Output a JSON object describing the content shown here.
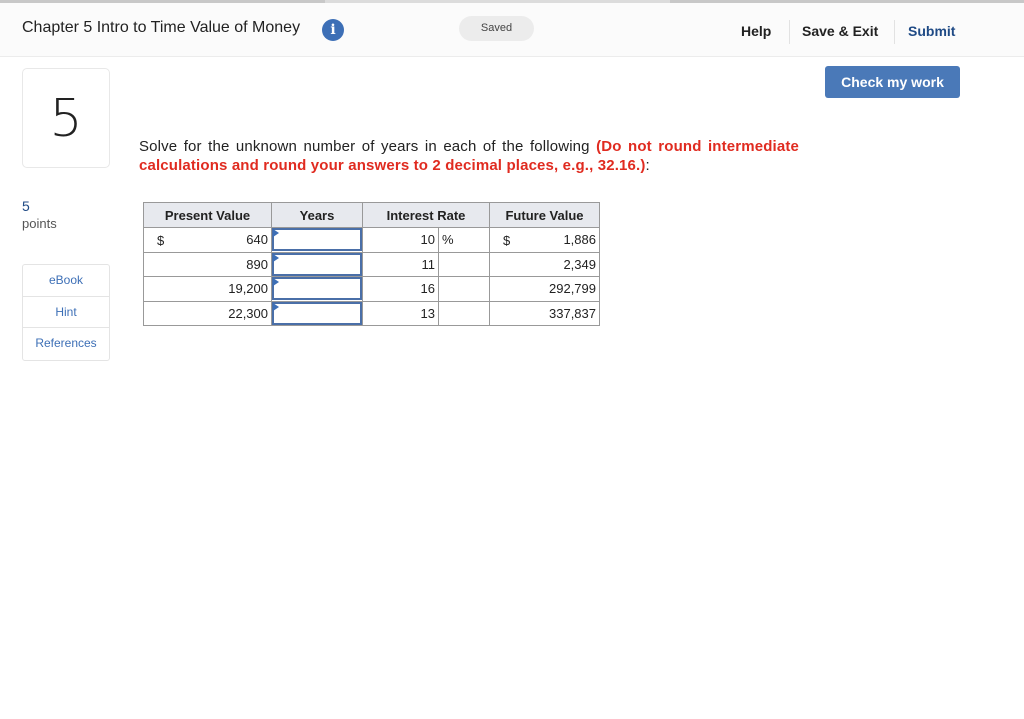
{
  "header": {
    "title": "Chapter 5 Intro to Time Value of Money",
    "info_icon": "i",
    "status": "Saved",
    "nav": {
      "help": "Help",
      "save_exit": "Save & Exit",
      "submit": "Submit"
    }
  },
  "actions": {
    "check_my_work": "Check my work"
  },
  "question": {
    "number": "5",
    "points_value": "5",
    "points_label": "points",
    "tools": [
      "eBook",
      "Hint",
      "References"
    ],
    "prompt_plain": "Solve for the unknown number of years in each of the following ",
    "prompt_emphasis": "(Do not round intermediate calculations and round your answers to 2 decimal places, e.g., 32.16.)",
    "prompt_end": ":"
  },
  "table": {
    "headers": [
      "Present Value",
      "Years",
      "Interest Rate",
      "Future Value"
    ],
    "currency_symbol": "$",
    "percent_symbol": "%",
    "rows": [
      {
        "present_value": "640",
        "years": "",
        "interest_rate": "10",
        "future_value": "1,886"
      },
      {
        "present_value": "890",
        "years": "",
        "interest_rate": "11",
        "future_value": "2,349"
      },
      {
        "present_value": "19,200",
        "years": "",
        "interest_rate": "16",
        "future_value": "292,799"
      },
      {
        "present_value": "22,300",
        "years": "",
        "interest_rate": "13",
        "future_value": "337,837"
      }
    ]
  }
}
